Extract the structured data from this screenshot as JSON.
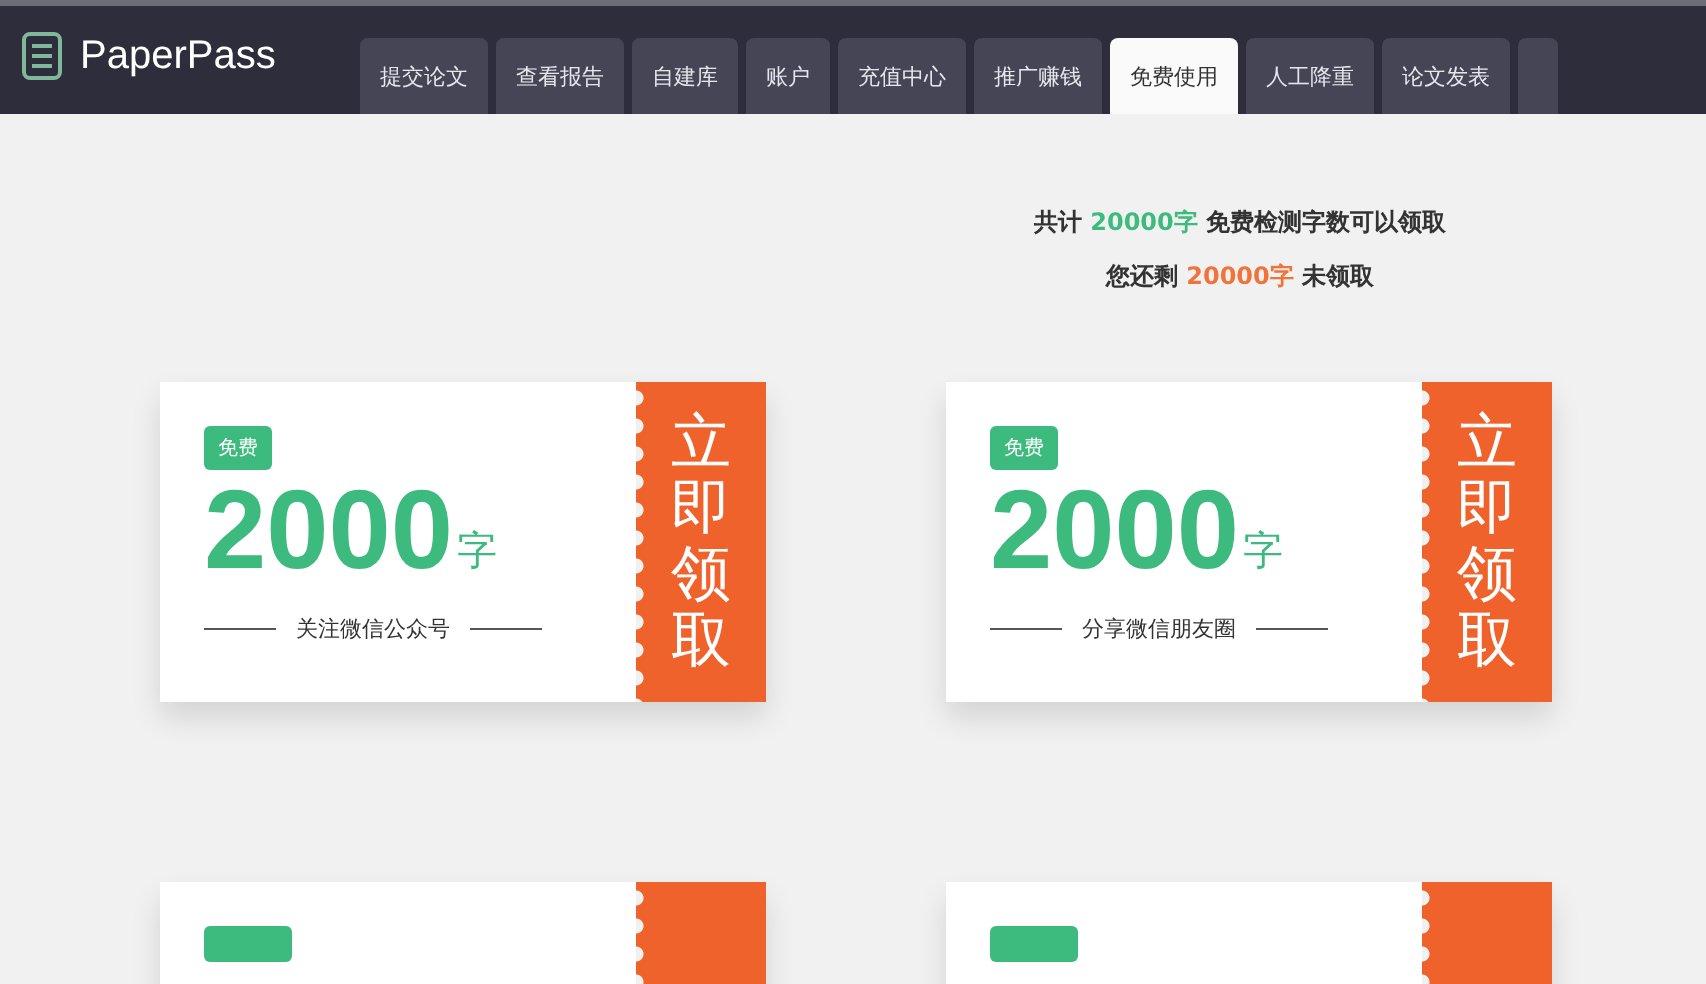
{
  "brand": {
    "name": "PaperPass"
  },
  "tabs": [
    {
      "label": "提交论文",
      "selected": false
    },
    {
      "label": "查看报告",
      "selected": false
    },
    {
      "label": "自建库",
      "selected": false
    },
    {
      "label": "账户",
      "selected": false
    },
    {
      "label": "充值中心",
      "selected": false
    },
    {
      "label": "推广赚钱",
      "selected": false
    },
    {
      "label": "免费使用",
      "selected": true
    },
    {
      "label": "人工降重",
      "selected": false
    },
    {
      "label": "论文发表",
      "selected": false
    },
    {
      "selected": false
    }
  ],
  "summary": [
    {
      "kind": "total",
      "before": "共计",
      "amount": "20000字",
      "after": "免费检测字数可以领取"
    },
    {
      "kind": "remaining",
      "before": "您还剩",
      "amount": "20000字",
      "after": "未领取"
    }
  ],
  "coupons": [
    {
      "kind": "full",
      "badge": "免费",
      "amount": "2000",
      "unit": "字",
      "task": "关注微信公众号",
      "action": "立即领取"
    },
    {
      "kind": "full",
      "badge": "免费",
      "amount": "2000",
      "unit": "字",
      "task": "分享微信朋友圈",
      "action": "立即领取"
    },
    {
      "kind": "partial"
    },
    {
      "kind": "partial"
    }
  ]
}
